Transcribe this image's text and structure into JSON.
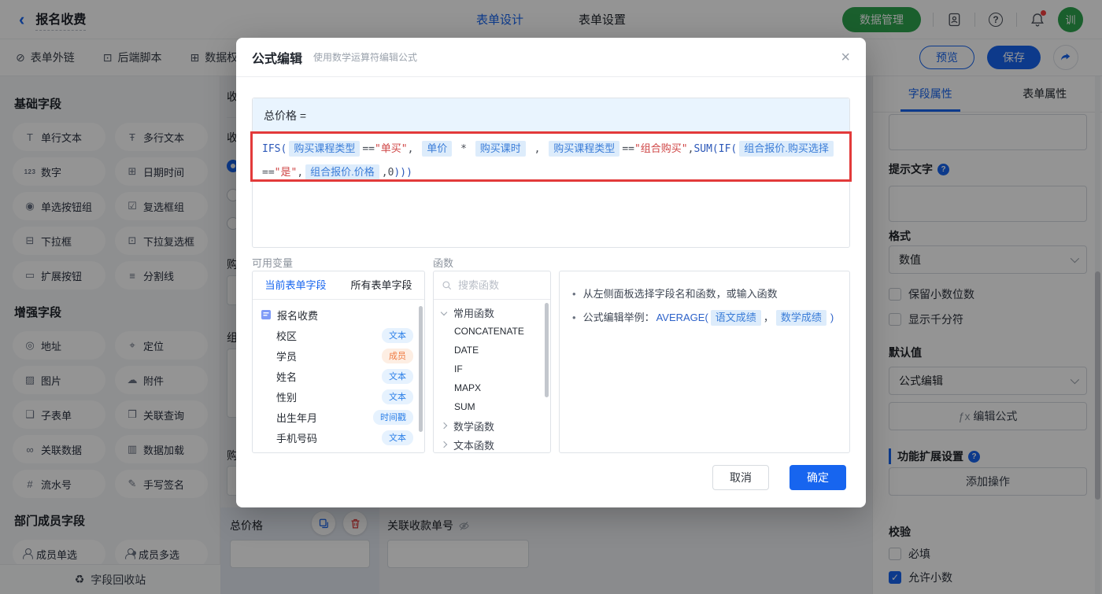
{
  "topbar": {
    "back_label": "报名收费",
    "tabs": [
      {
        "label": "表单设计",
        "active": true
      },
      {
        "label": "表单设置",
        "active": false
      }
    ],
    "data_manage_label": "数据管理",
    "avatar_text": "训"
  },
  "toolbar": {
    "items": [
      {
        "label": "表单外链",
        "icon": "link-icon",
        "glyph": "⊘"
      },
      {
        "label": "后端脚本",
        "icon": "script-icon",
        "glyph": "⊡"
      },
      {
        "label": "数据权",
        "icon": "data-permission-icon",
        "glyph": "⊞"
      }
    ],
    "preview_label": "预览",
    "save_label": "保存"
  },
  "sidebar": {
    "sections": [
      {
        "title": "基础字段",
        "items": [
          {
            "label": "单行文本",
            "icon": "single-line-text-icon",
            "glyph": "T"
          },
          {
            "label": "多行文本",
            "icon": "multi-line-text-icon",
            "glyph": "Ŧ"
          },
          {
            "label": "数字",
            "icon": "number-icon",
            "glyph": "123"
          },
          {
            "label": "日期时间",
            "icon": "datetime-icon",
            "glyph": "⊞"
          },
          {
            "label": "单选按钮组",
            "icon": "radio-group-icon",
            "glyph": "◉"
          },
          {
            "label": "复选框组",
            "icon": "checkbox-group-icon",
            "glyph": "☑"
          },
          {
            "label": "下拉框",
            "icon": "dropdown-icon",
            "glyph": "⊟"
          },
          {
            "label": "下拉复选框",
            "icon": "multi-dropdown-icon",
            "glyph": "⊡"
          },
          {
            "label": "扩展按钮",
            "icon": "extend-button-icon",
            "glyph": "▭"
          },
          {
            "label": "分割线",
            "icon": "divider-icon",
            "glyph": "≡"
          }
        ]
      },
      {
        "title": "增强字段",
        "items": [
          {
            "label": "地址",
            "icon": "address-icon",
            "glyph": "◎"
          },
          {
            "label": "定位",
            "icon": "location-icon",
            "glyph": "⌖"
          },
          {
            "label": "图片",
            "icon": "image-icon",
            "glyph": "▨"
          },
          {
            "label": "附件",
            "icon": "attachment-icon",
            "glyph": "☁"
          },
          {
            "label": "子表单",
            "icon": "subform-icon",
            "glyph": "❑"
          },
          {
            "label": "关联查询",
            "icon": "relation-query-icon",
            "glyph": "❒"
          },
          {
            "label": "关联数据",
            "icon": "relation-data-icon",
            "glyph": "∞"
          },
          {
            "label": "数据加载",
            "icon": "data-load-icon",
            "glyph": "▥"
          },
          {
            "label": "流水号",
            "icon": "serial-number-icon",
            "glyph": "#"
          },
          {
            "label": "手写签名",
            "icon": "signature-icon",
            "glyph": "✎"
          }
        ]
      },
      {
        "title": "部门成员字段",
        "items": [
          {
            "label": "成员单选",
            "icon": "member-single-icon",
            "glyph": "p1"
          },
          {
            "label": "成员多选",
            "icon": "member-multi-icon",
            "glyph": "p2"
          }
        ]
      }
    ],
    "recycle_label": "字段回收站",
    "recycle_glyph": "♻"
  },
  "canvas": {
    "partial_labels": [
      "收",
      "收",
      "购",
      "组",
      "购"
    ],
    "total_price_label": "总价格",
    "related_field_label": "关联收款单号"
  },
  "modal": {
    "title": "公式编辑",
    "subtitle": "使用数学运算符编辑公式",
    "close_glyph": "×",
    "formula_target": "总价格 =",
    "formula_tokens": [
      {
        "t": "fn",
        "v": "IFS("
      },
      {
        "t": "chip",
        "v": "购买课程类型"
      },
      {
        "t": "op",
        "v": "=="
      },
      {
        "t": "str",
        "v": "\"单买\""
      },
      {
        "t": "op",
        "v": ", "
      },
      {
        "t": "chip",
        "v": "单价"
      },
      {
        "t": "op",
        "v": " * "
      },
      {
        "t": "chip",
        "v": "购买课时"
      },
      {
        "t": "op",
        "v": " , "
      },
      {
        "t": "chip",
        "v": "购买课程类型"
      },
      {
        "t": "op",
        "v": "=="
      },
      {
        "t": "str",
        "v": "\"组合购买\""
      },
      {
        "t": "op",
        "v": ","
      },
      {
        "t": "fn",
        "v": "SUM(IF("
      },
      {
        "t": "chip",
        "v": "组合报价.购买选择"
      },
      {
        "t": "op",
        "v": "=="
      },
      {
        "t": "str",
        "v": "\"是\""
      },
      {
        "t": "op",
        "v": ","
      },
      {
        "t": "chip",
        "v": "组合报价.价格"
      },
      {
        "t": "op",
        "v": ",0"
      },
      {
        "t": "fn",
        "v": ")))"
      }
    ],
    "variables": {
      "label": "可用变量",
      "tabs": [
        {
          "label": "当前表单字段",
          "active": true
        },
        {
          "label": "所有表单字段",
          "active": false
        }
      ],
      "root": "报名收费",
      "fields": [
        {
          "name": "校区",
          "type": "文本",
          "type_color": "blue"
        },
        {
          "name": "学员",
          "type": "成员",
          "type_color": "orange"
        },
        {
          "name": "姓名",
          "type": "文本",
          "type_color": "blue"
        },
        {
          "name": "性别",
          "type": "文本",
          "type_color": "blue"
        },
        {
          "name": "出生年月",
          "type": "时间戳",
          "type_color": "blue"
        },
        {
          "name": "手机号码",
          "type": "文本",
          "type_color": "blue"
        }
      ]
    },
    "functions": {
      "label": "函数",
      "search_placeholder": "搜索函数",
      "groups": [
        {
          "label": "常用函数",
          "expanded": true,
          "items": [
            "CONCATENATE",
            "DATE",
            "IF",
            "MAPX",
            "SUM"
          ]
        },
        {
          "label": "数学函数",
          "expanded": false,
          "items": []
        },
        {
          "label": "文本函数",
          "expanded": false,
          "items": []
        }
      ]
    },
    "help": {
      "bullet1": "从左侧面板选择字段名和函数，或输入函数",
      "example_prefix": "公式编辑举例：",
      "example_fn": "AVERAGE(",
      "example_field1": "语文成绩",
      "example_comma": "，",
      "example_field2": "数学成绩",
      "example_close": ")"
    },
    "cancel_label": "取消",
    "ok_label": "确定"
  },
  "panel": {
    "tabs": [
      {
        "label": "字段属性",
        "active": true
      },
      {
        "label": "表单属性",
        "active": false
      }
    ],
    "hint_label": "提示文字",
    "format_label": "格式",
    "format_value": "数值",
    "decimal_checkbox_label": "保留小数位数",
    "thousand_checkbox_label": "显示千分符",
    "default_label": "默认值",
    "default_value": "公式编辑",
    "fx_prefix": "ƒx",
    "fx_button_label": "编辑公式",
    "extension_label": "功能扩展设置",
    "add_action_label": "添加操作",
    "validation_label": "校验",
    "required_label": "必填",
    "allow_decimal_label": "允许小数",
    "check_glyph": "✓"
  },
  "colors": {
    "brand_blue": "#1765ef",
    "green": "#2da44e",
    "formula_function": "#2b57b8",
    "formula_string": "#cf4545",
    "chip_text": "#3b7dd8",
    "chip_bg": "#ddecfb",
    "highlight_red": "#e23a3a",
    "badge_orange": "#ef7a41"
  }
}
